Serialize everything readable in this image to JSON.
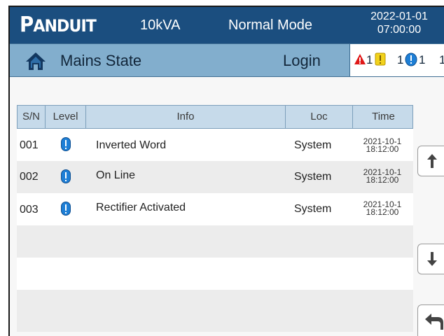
{
  "header": {
    "brand": "PANDUIT",
    "brand_parts": [
      "P",
      "ANDUIT"
    ],
    "capacity": "10kVA",
    "mode": "Normal Mode",
    "date": "2022-01-01",
    "time": "07:00:00",
    "bg_color": "#1b4e7f"
  },
  "subheader": {
    "home_icon": "home-icon",
    "title": "Mains State",
    "login_label": "Login",
    "alarms": {
      "critical_count": "1",
      "warning_count": "1",
      "info_count": "1",
      "trailing": "1"
    },
    "bg_color": "#82aecd"
  },
  "table": {
    "columns": [
      "S/N",
      "Level",
      "Info",
      "Loc",
      "Time"
    ],
    "rows": [
      {
        "sn": "001",
        "level": "info",
        "info": "Inverted Word",
        "loc": "System",
        "date": "2021-10-1",
        "time": "18:12:00"
      },
      {
        "sn": "002",
        "level": "info",
        "info": "On Line",
        "loc": "System",
        "date": "2021-10-1",
        "time": "18:12:00"
      },
      {
        "sn": "003",
        "level": "info",
        "info": "Rectifier Activated",
        "loc": "System",
        "date": "2021-10-1",
        "time": "18:12:00"
      }
    ],
    "empty_rows": 3
  },
  "side_buttons": {
    "up_icon": "arrow-up-icon",
    "down_icon": "arrow-down-icon",
    "back_icon": "return-icon"
  }
}
